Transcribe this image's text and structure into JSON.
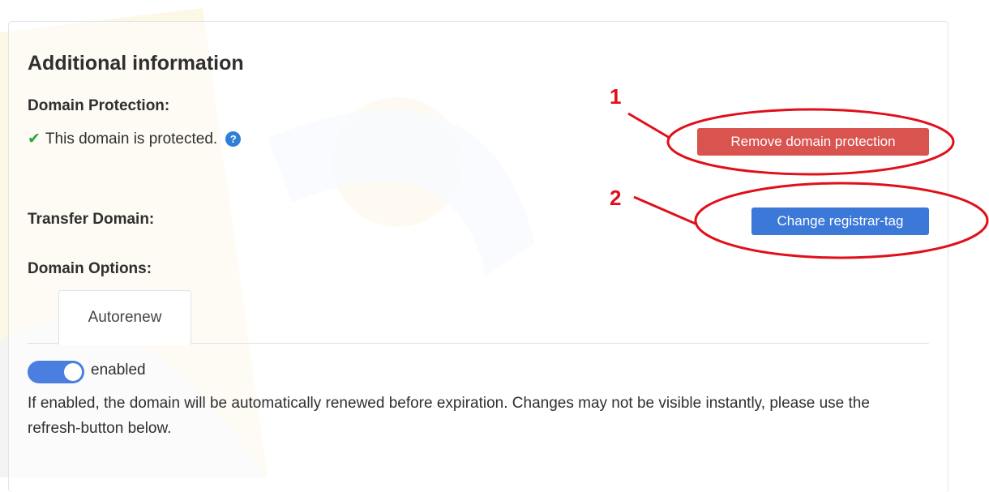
{
  "section": {
    "title": "Additional information"
  },
  "domain_protection": {
    "label": "Domain Protection:",
    "status_text": "This domain is protected.",
    "help_glyph": "?",
    "remove_button": "Remove domain protection"
  },
  "transfer": {
    "label": "Transfer Domain:",
    "change_button": "Change registrar-tag"
  },
  "options": {
    "label": "Domain Options:",
    "tabs": [
      {
        "label": "Autorenew"
      }
    ],
    "toggle_label": "enabled",
    "toggle_state": true,
    "description": "If enabled, the domain will be automatically renewed before expiration. Changes may not be visible instantly, please use the refresh-button below."
  },
  "annotations": [
    {
      "number": "1"
    },
    {
      "number": "2"
    }
  ],
  "colors": {
    "danger": "#d9534f",
    "primary": "#3b78d8",
    "toggle_on": "#4a7fe0",
    "annotation": "#e10f1a",
    "success": "#28a745"
  }
}
